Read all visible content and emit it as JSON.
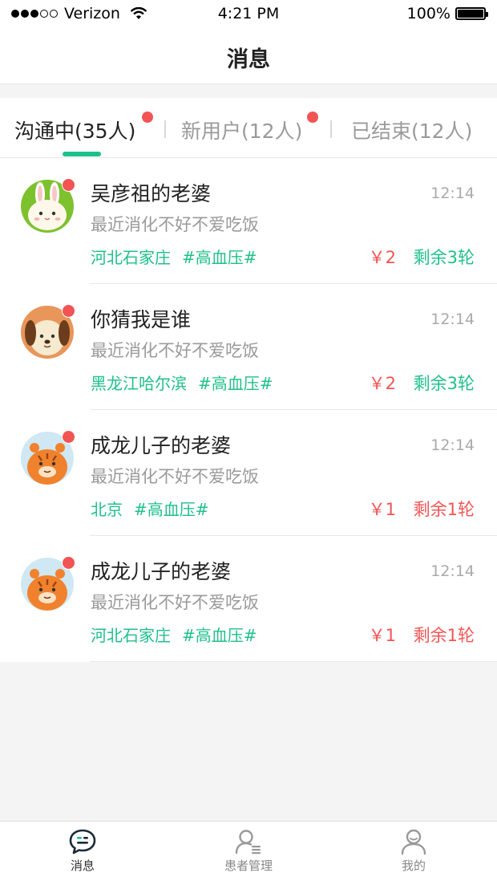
{
  "status_bar": {
    "carrier": "Verizon",
    "time": "4:21 PM",
    "battery": "100%"
  },
  "nav": {
    "title": "消息"
  },
  "tabs": [
    {
      "label": "沟通中(35人)",
      "active": true,
      "has_dot": true
    },
    {
      "label": "新用户(12人)",
      "active": false,
      "has_dot": true
    },
    {
      "label": "已结束(12人)",
      "active": false,
      "has_dot": false
    }
  ],
  "messages": [
    {
      "name": "吴彦祖的老婆",
      "time": "12:14",
      "preview": "最近消化不好不爱吃饭",
      "location": "河北石家庄",
      "tag": "#高血压#",
      "price": "￥2",
      "remaining": "剩余3轮",
      "remaining_color": "green",
      "avatar": "rabbit-avatar"
    },
    {
      "name": "你猜我是谁",
      "time": "12:14",
      "preview": "最近消化不好不爱吃饭",
      "location": "黑龙江哈尔滨",
      "tag": "#高血压#",
      "price": "￥2",
      "remaining": "剩余3轮",
      "remaining_color": "green",
      "avatar": "dog-avatar"
    },
    {
      "name": "成龙儿子的老婆",
      "time": "12:14",
      "preview": "最近消化不好不爱吃饭",
      "location": "北京",
      "tag": "#高血压#",
      "price": "￥1",
      "remaining": "剩余1轮",
      "remaining_color": "red",
      "avatar": "tiger-avatar"
    },
    {
      "name": "成龙儿子的老婆",
      "time": "12:14",
      "preview": "最近消化不好不爱吃饭",
      "location": "河北石家庄",
      "tag": "#高血压#",
      "price": "￥1",
      "remaining": "剩余1轮",
      "remaining_color": "red",
      "avatar": "tiger-avatar"
    }
  ],
  "tab_bar": [
    {
      "label": "消息",
      "icon": "chat-icon",
      "active": true
    },
    {
      "label": "患者管理",
      "icon": "patient-manage-icon",
      "active": false
    },
    {
      "label": "我的",
      "icon": "profile-icon",
      "active": false
    }
  ],
  "colors": {
    "accent_green": "#1fc08b",
    "alert_red": "#f25454"
  }
}
